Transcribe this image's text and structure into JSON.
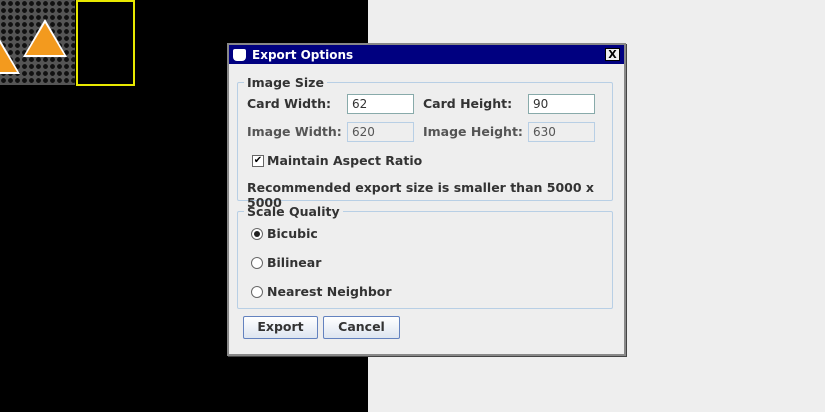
{
  "dialog": {
    "title": "Export Options",
    "close_label": "X"
  },
  "image_size": {
    "legend": "Image Size",
    "card_width_label": "Card Width:",
    "card_width": "62",
    "card_height_label": "Card Height:",
    "card_height": "90",
    "image_width_label": "Image Width:",
    "image_width": "620",
    "image_height_label": "Image Height:",
    "image_height": "630",
    "aspect_label": "Maintain Aspect Ratio",
    "aspect_checked": true,
    "recommend": "Recommended export size is smaller than 5000 x 5000"
  },
  "scale_quality": {
    "legend": "Scale Quality",
    "options": [
      "Bicubic",
      "Bilinear",
      "Nearest Neighbor"
    ],
    "selected": "Bicubic"
  },
  "buttons": {
    "export": "Export",
    "cancel": "Cancel"
  }
}
